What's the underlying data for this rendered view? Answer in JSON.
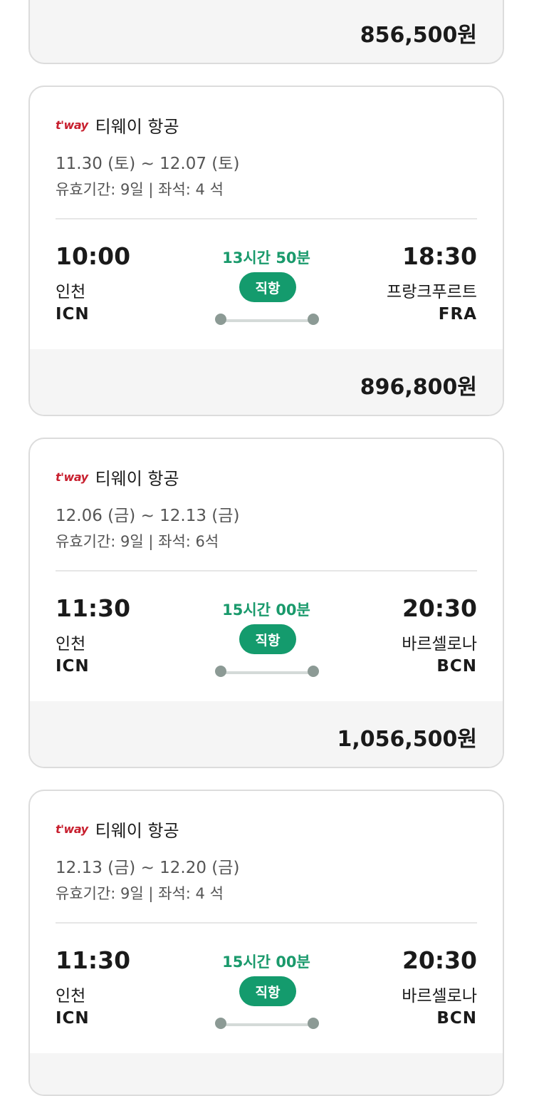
{
  "top_card": {
    "price": "856,500원"
  },
  "flights": [
    {
      "airline_logo": "t'way",
      "airline": "티웨이 항공",
      "dates": "11.30 (토) ~ 12.07 (토)",
      "meta": "유효기간: 9일 | 좌석: 4 석",
      "dep_time": "10:00",
      "dep_city": "인천",
      "dep_code": "ICN",
      "duration": "13시간 50분",
      "badge": "직항",
      "arr_time": "18:30",
      "arr_city": "프랑크푸르트",
      "arr_code": "FRA",
      "price": "896,800원"
    },
    {
      "airline_logo": "t'way",
      "airline": "티웨이 항공",
      "dates": "12.06 (금) ~ 12.13 (금)",
      "meta": "유효기간: 9일 | 좌석: 6석",
      "dep_time": "11:30",
      "dep_city": "인천",
      "dep_code": "ICN",
      "duration": "15시간 00분",
      "badge": "직항",
      "arr_time": "20:30",
      "arr_city": "바르셀로나",
      "arr_code": "BCN",
      "price": "1,056,500원"
    },
    {
      "airline_logo": "t'way",
      "airline": "티웨이 항공",
      "dates": "12.13 (금) ~ 12.20 (금)",
      "meta": "유효기간: 9일 | 좌석: 4 석",
      "dep_time": "11:30",
      "dep_city": "인천",
      "dep_code": "ICN",
      "duration": "15시간 00분",
      "badge": "직항",
      "arr_time": "20:30",
      "arr_city": "바르셀로나",
      "arr_code": "BCN",
      "price": ""
    }
  ],
  "colors": {
    "accent": "#149b6d",
    "duration_text": "#1a9a6c",
    "logo": "#c8202f"
  }
}
